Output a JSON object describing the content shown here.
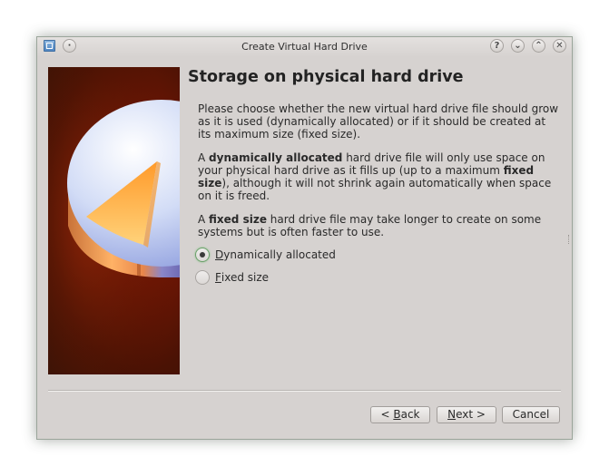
{
  "window": {
    "title": "Create Virtual Hard Drive"
  },
  "titlebar_buttons": {
    "help": "?",
    "minimize": "⌄",
    "maximize": "⌃",
    "close": "✕",
    "menu": "·"
  },
  "page": {
    "heading": "Storage on physical hard drive",
    "para1": "Please choose whether the new virtual hard drive file should grow as it is used (dynamically allocated) or if it should be created at its maximum size (fixed size).",
    "para2": {
      "a": "A ",
      "b1": "dynamically allocated",
      "c": " hard drive file will only use space on your physical hard drive as it fills up (up to a maximum ",
      "b2": "fixed size",
      "d": "), although it will not shrink again automatically when space on it is freed."
    },
    "para3": {
      "a": "A ",
      "b1": "fixed size",
      "c": " hard drive file may take longer to create on some systems but is often faster to use."
    }
  },
  "options": [
    {
      "label_first": "D",
      "label_rest": "ynamically allocated",
      "checked": true
    },
    {
      "label_first": "F",
      "label_rest": "ixed size",
      "checked": false
    }
  ],
  "buttons": {
    "back_prefix": "< ",
    "back_mnemonic": "B",
    "back_rest": "ack",
    "next_mnemonic": "N",
    "next_rest": "ext >",
    "cancel": "Cancel"
  },
  "colors": {
    "window_bg": "#d6d2d0",
    "accent_green": "#6aa06a",
    "side_image_bg": "#6e1604"
  },
  "icons": {
    "app": "virtualbox-icon",
    "side_image": "disk-pie-illustration"
  }
}
